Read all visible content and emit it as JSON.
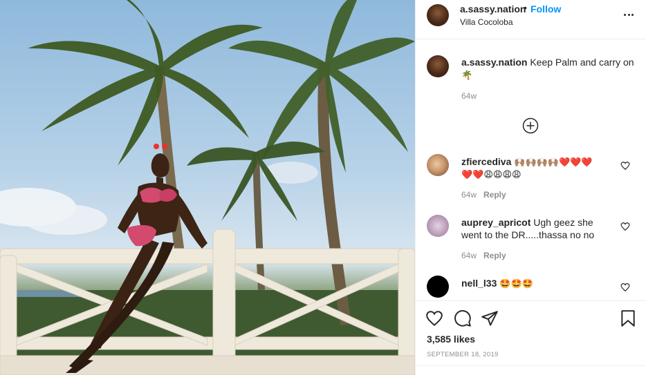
{
  "post": {
    "username": "a.sassy.nation",
    "follow_label": "Follow",
    "dot": "•",
    "location": "Villa Cocoloba"
  },
  "caption": {
    "username": "a.sassy.nation",
    "text": "Keep Palm and carry on",
    "emoji": "🌴",
    "age": "64w"
  },
  "comments": [
    {
      "username": "zfiercediva",
      "text": "🙌🏽🙌🏽🙌🏽🙌🏽❤️❤️❤️",
      "text2": "❤️❤️😩😩😩😩",
      "age": "64w",
      "reply_label": "Reply"
    },
    {
      "username": "auprey_apricot",
      "text": "Ugh geez she",
      "text2": "went to the DR.....thassa no no",
      "age": "64w",
      "reply_label": "Reply"
    },
    {
      "username": "nell_l33",
      "text": "🤩🤩🤩"
    }
  ],
  "likes": "3,585 likes",
  "date": "September 18, 2019",
  "icons": {
    "more": "more-options-icon",
    "load_more": "plus-circle-icon",
    "like": "heart-icon",
    "comment": "comment-bubble-icon",
    "share": "paper-plane-icon",
    "save": "bookmark-icon"
  },
  "colors": {
    "accent": "#0095f6",
    "muted": "#8e8e8e",
    "text": "#262626"
  }
}
